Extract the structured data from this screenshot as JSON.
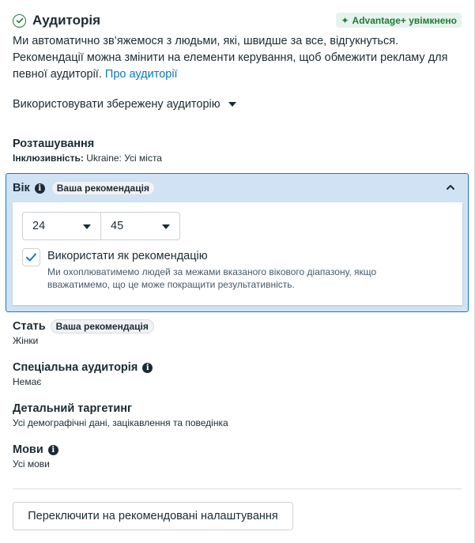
{
  "header": {
    "title": "Аудиторія",
    "advantage_badge": "Advantage+ увімкнено"
  },
  "description": {
    "text": "Ми автоматично зв’яжемося з людьми, які, швидше за все, відгукнуться. Рекомендації можна змінити на елементи керування, щоб обмежити рекламу для певної аудиторії.",
    "link": "Про аудиторії"
  },
  "saved_audience": {
    "label": "Використовувати збережену аудиторію"
  },
  "location": {
    "title": "Розташування",
    "inclusivity_label": "Інклюзивність:",
    "inclusivity_value": "Ukraine: Усі міста"
  },
  "age": {
    "title": "Вік",
    "badge": "Ваша рекомендація",
    "min": "24",
    "max": "45",
    "use_as_recommendation": {
      "label": "Використати як рекомендацію",
      "checked": true,
      "help": "Ми охоплюватимемо людей за межами вказаного вікового діапазону, якщо вважатимемо, що це може покращити результативність."
    }
  },
  "gender": {
    "title": "Стать",
    "badge": "Ваша рекомендація",
    "value": "Жінки"
  },
  "custom_audience": {
    "title": "Спеціальна аудиторія",
    "value": "Немає"
  },
  "detailed_targeting": {
    "title": "Детальний таргетинг",
    "value": "Усі демографічні дані, зацікавлення та поведінка"
  },
  "languages": {
    "title": "Мови",
    "value": "Усі мови"
  },
  "footer": {
    "switch_button": "Переключити на рекомендовані налаштування"
  },
  "colors": {
    "accent": "#1877c8",
    "link": "#0a78be",
    "success": "#1d7a3a",
    "section_bg": "#cfe3f5"
  }
}
